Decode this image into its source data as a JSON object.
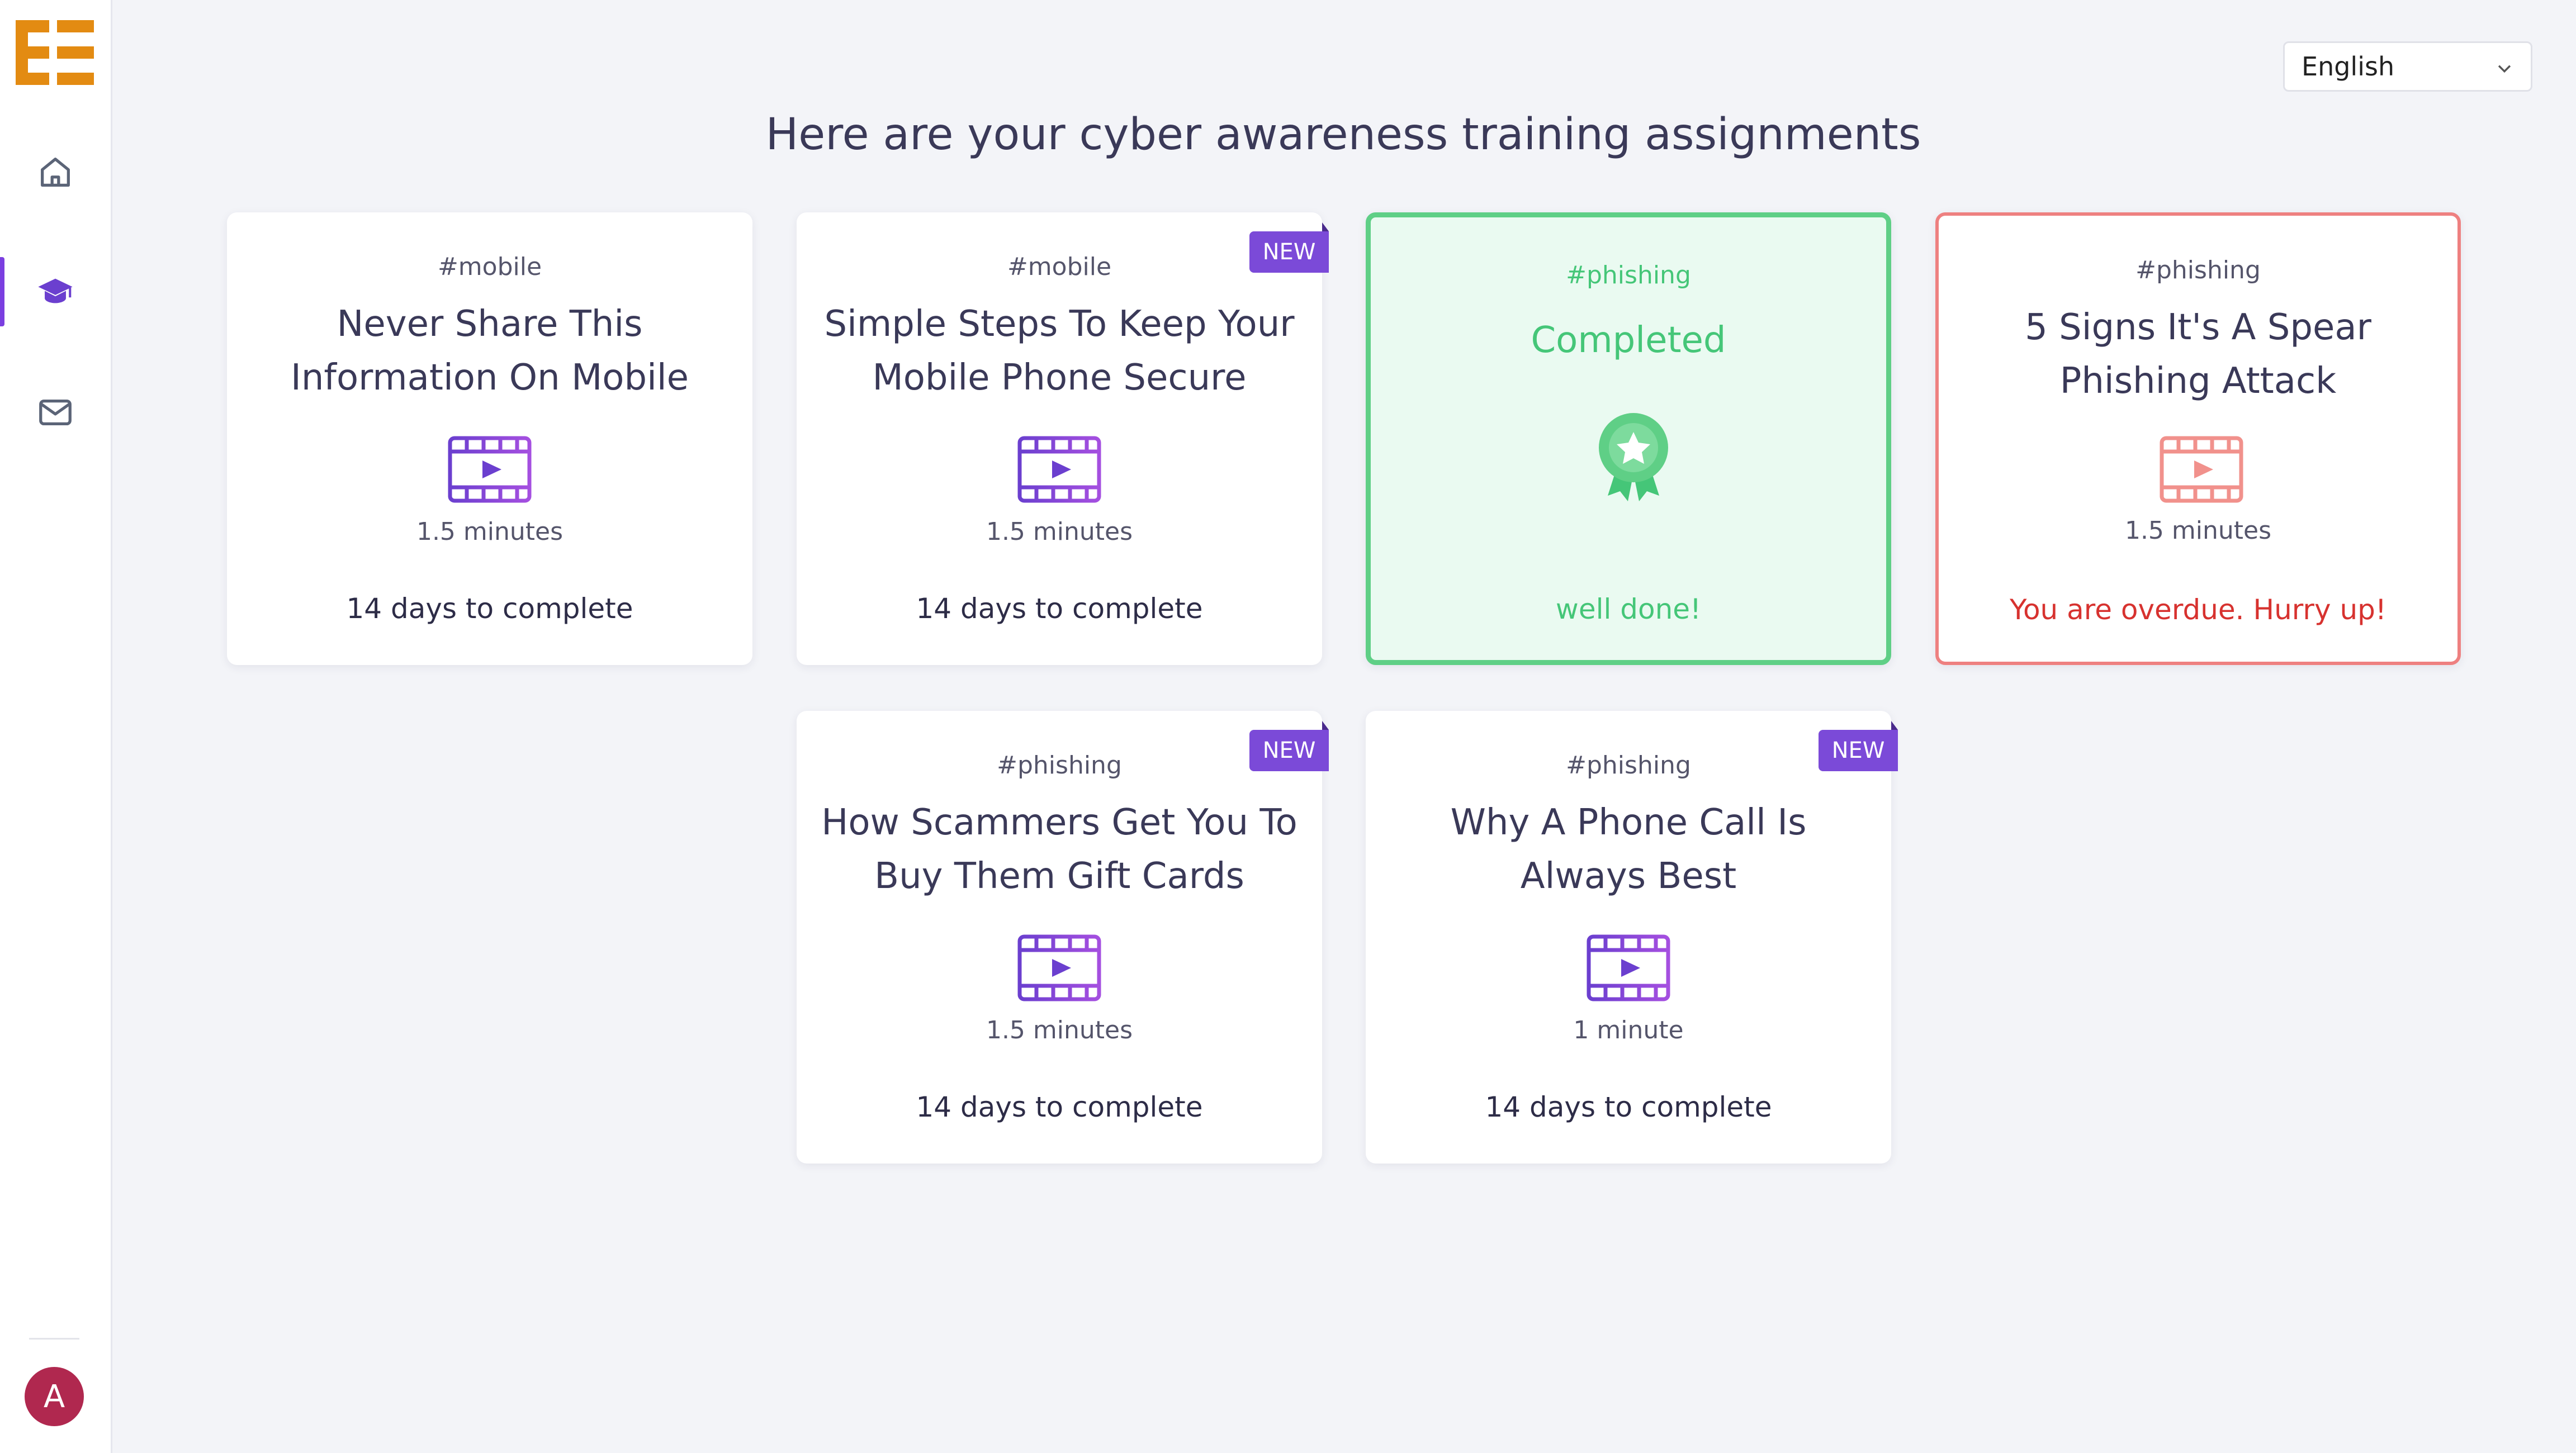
{
  "sidebar": {
    "logo": "EE",
    "nav": [
      {
        "icon": "home-icon"
      },
      {
        "icon": "graduation-cap-icon",
        "active": true
      },
      {
        "icon": "mail-icon"
      }
    ],
    "avatar_initial": "A"
  },
  "language": {
    "selected": "English"
  },
  "heading": "Here are your cyber awareness training assignments",
  "badge_label": "NEW",
  "cards": [
    {
      "tag": "#mobile",
      "title": "Never Share This Information On Mobile",
      "duration": "1.5 minutes",
      "deadline": "14 days to complete"
    },
    {
      "tag": "#mobile",
      "title": "Simple Steps To Keep Your Mobile Phone Secure",
      "duration": "1.5 minutes",
      "deadline": "14 days to complete"
    },
    {
      "tag": "#phishing",
      "title": "Completed",
      "message": "well done!"
    },
    {
      "tag": "#phishing",
      "title": "5 Signs It's A Spear Phishing Attack",
      "duration": "1.5 minutes",
      "deadline": "You are overdue. Hurry up!"
    },
    {
      "tag": "#phishing",
      "title": "How Scammers Get You To Buy Them Gift Cards",
      "duration": "1.5 minutes",
      "deadline": "14 days to complete"
    },
    {
      "tag": "#phishing",
      "title": "Why A Phone Call Is Always Best",
      "duration": "1 minute",
      "deadline": "14 days to complete"
    }
  ],
  "colors": {
    "accent": "#7b4ad8",
    "logo": "#e38b12",
    "success": "#45c678",
    "danger": "#d7322f"
  }
}
